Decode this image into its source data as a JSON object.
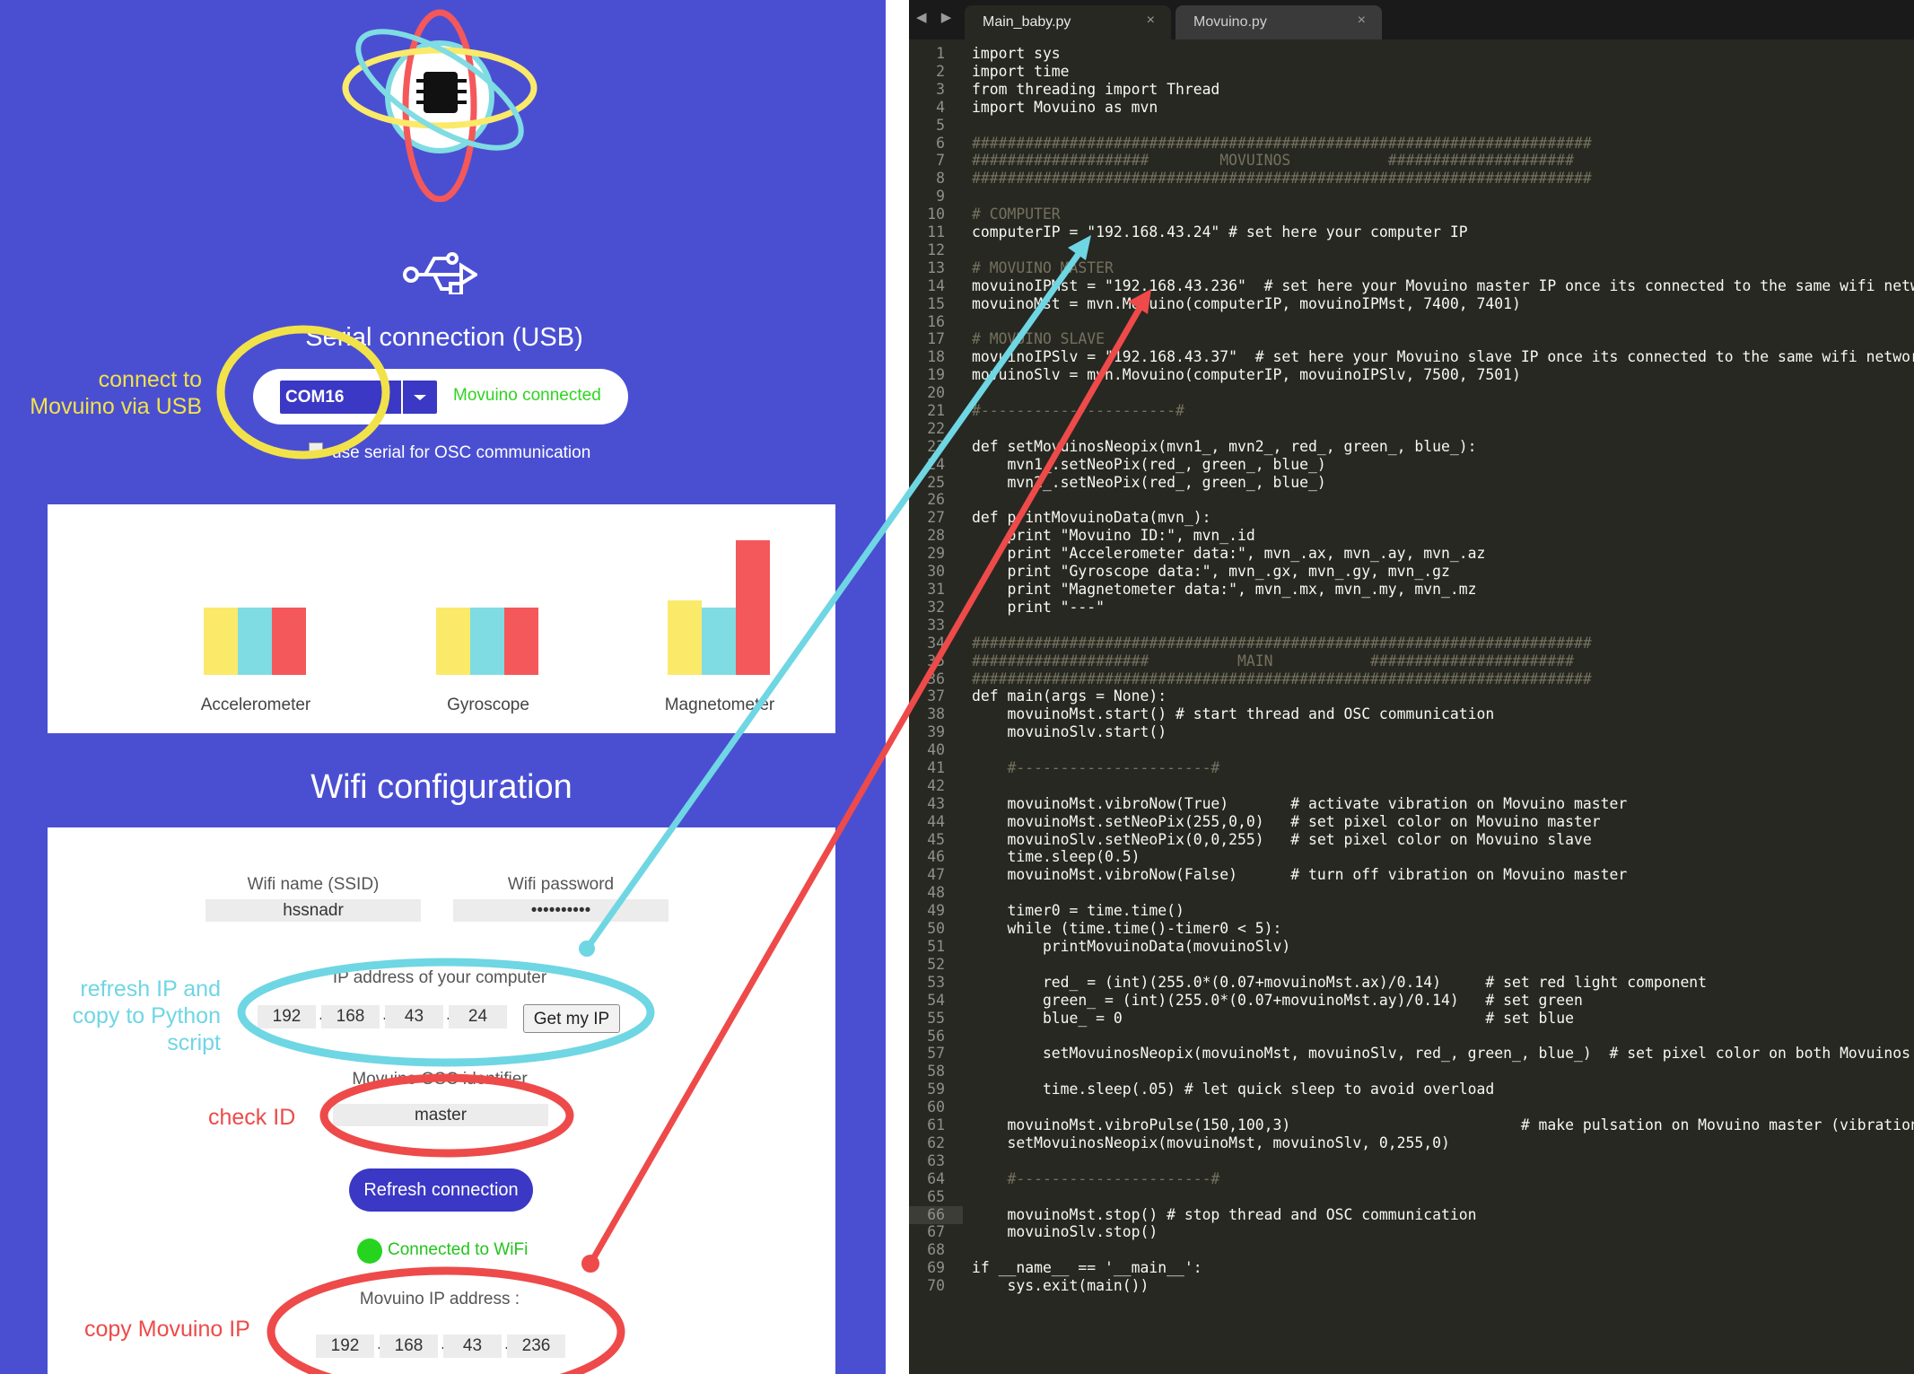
{
  "app": {
    "serial_title": "Serial connection (USB)",
    "com_port": "COM16",
    "serial_status": "Movuino connected",
    "osc_label": "use serial for OSC communication",
    "sensors": [
      {
        "name": "Accelerometer",
        "levels": [
          0.5,
          0.5,
          0.5
        ]
      },
      {
        "name": "Gyroscope",
        "levels": [
          0.5,
          0.5,
          0.5
        ]
      },
      {
        "name": "Magnetometer",
        "levels": [
          0.55,
          0.5,
          1.0
        ]
      }
    ],
    "colors": {
      "yellow": "#fbe96a",
      "cyan": "#7fdce2",
      "red": "#f4585a",
      "accent": "#4a4fd2",
      "button": "#3a38c4"
    },
    "wifi_title": "Wifi configuration",
    "ssid_label": "Wifi name (SSID)",
    "ssid_value": "hssnadr",
    "password_label": "Wifi password",
    "password_value": "••••••••••",
    "ip_label": "IP address of your computer",
    "computer_ip": [
      "192",
      "168",
      "43",
      "24"
    ],
    "get_ip_button": "Get my IP",
    "osc_id_label": "Movuino OSC identifier",
    "osc_id_value": "master",
    "refresh_button": "Refresh connection",
    "wifi_status": "Connected to WiFi",
    "movuino_ip_label": "Movuino IP address :",
    "movuino_ip": [
      "192",
      "168",
      "43",
      "236"
    ]
  },
  "annotations": {
    "usb": "connect to\nMovuino via USB",
    "refresh": "refresh IP and\ncopy to Python\nscript",
    "check_id": "check ID",
    "copy_ip": "copy Movuino IP"
  },
  "editor": {
    "tabs": [
      {
        "label": "Main_baby.py",
        "active": true
      },
      {
        "label": "Movuino.py",
        "active": false
      }
    ],
    "nav_arrows": "◀ ▶",
    "close_glyph": "×",
    "current_line": 66,
    "lines": [
      "import sys",
      "import time",
      "from threading import Thread",
      "import Movuino as mvn",
      "",
      "######################################################################",
      "####################        MOVUINOS           #####################",
      "######################################################################",
      "",
      "# COMPUTER",
      "computerIP = \"192.168.43.24\" # set here your computer IP",
      "",
      "# MOVUINO MASTER",
      "movuinoIPMst = \"192.168.43.236\"  # set here your Movuino master IP once its connected to the same wifi network",
      "movuinoMst = mvn.Movuino(computerIP, movuinoIPMst, 7400, 7401)",
      "",
      "# MOVUINO SLAVE",
      "movuinoIPSlv = \"192.168.43.37\"  # set here your Movuino slave IP once its connected to the same wifi network",
      "movuinoSlv = mvn.Movuino(computerIP, movuinoIPSlv, 7500, 7501)",
      "",
      "#----------------------#",
      "",
      "def setMovuinosNeopix(mvn1_, mvn2_, red_, green_, blue_):",
      "    mvn1_.setNeoPix(red_, green_, blue_)",
      "    mvn2_.setNeoPix(red_, green_, blue_)",
      "",
      "def printMovuinoData(mvn_):",
      "    print \"Movuino ID:\", mvn_.id",
      "    print \"Accelerometer data:\", mvn_.ax, mvn_.ay, mvn_.az",
      "    print \"Gyroscope data:\", mvn_.gx, mvn_.gy, mvn_.gz",
      "    print \"Magnetometer data:\", mvn_.mx, mvn_.my, mvn_.mz",
      "    print \"---\"",
      "",
      "######################################################################",
      "####################          MAIN           #######################",
      "######################################################################",
      "def main(args = None):",
      "    movuinoMst.start() # start thread and OSC communication",
      "    movuinoSlv.start()",
      "",
      "    #----------------------#",
      "",
      "    movuinoMst.vibroNow(True)       # activate vibration on Movuino master",
      "    movuinoMst.setNeoPix(255,0,0)   # set pixel color on Movuino master",
      "    movuinoSlv.setNeoPix(0,0,255)   # set pixel color on Movuino slave",
      "    time.sleep(0.5)",
      "    movuinoMst.vibroNow(False)      # turn off vibration on Movuino master",
      "",
      "    timer0 = time.time()",
      "    while (time.time()-timer0 < 5):",
      "        printMovuinoData(movuinoSlv)",
      "",
      "        red_ = (int)(255.0*(0.07+movuinoMst.ax)/0.14)     # set red light component",
      "        green_ = (int)(255.0*(0.07+movuinoMst.ay)/0.14)   # set green",
      "        blue_ = 0                                         # set blue",
      "",
      "        setMovuinosNeopix(movuinoMst, movuinoSlv, red_, green_, blue_)  # set pixel color on both Movuinos",
      "",
      "        time.sleep(.05) # let quick sleep to avoid overload",
      "",
      "    movuinoMst.vibroPulse(150,100,3)                          # make pulsation on Movuino master (vibration)",
      "    setMovuinosNeopix(movuinoMst, movuinoSlv, 0,255,0)",
      "",
      "    #----------------------#",
      "",
      "    movuinoMst.stop() # stop thread and OSC communication",
      "    movuinoSlv.stop()",
      "",
      "if __name__ == '__main__':",
      "    sys.exit(main())"
    ]
  }
}
